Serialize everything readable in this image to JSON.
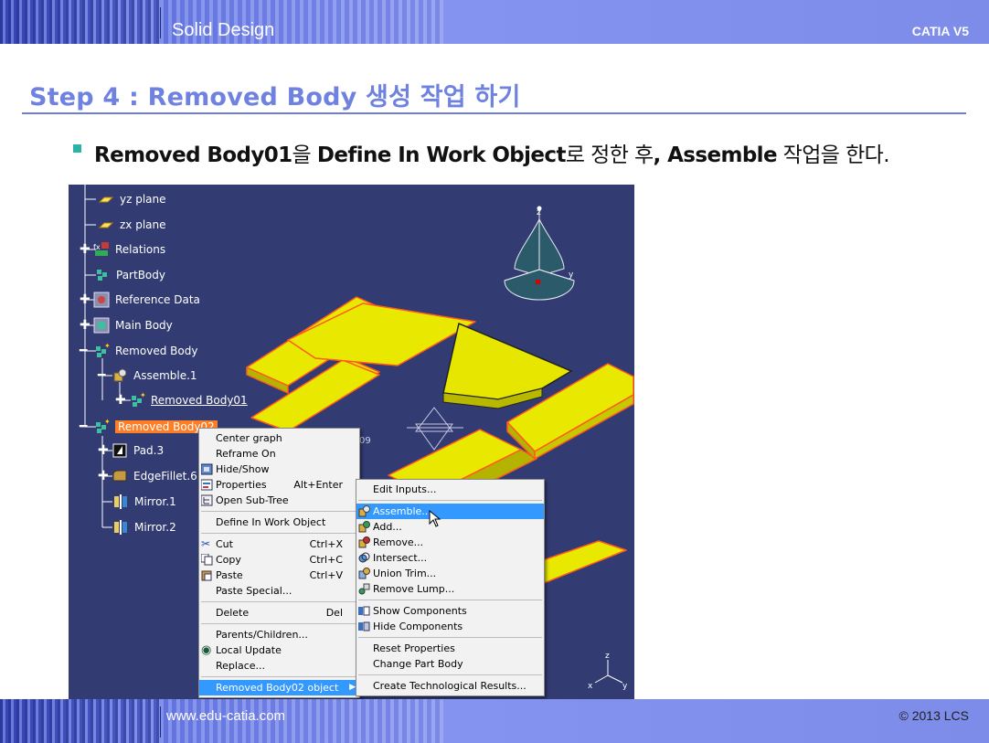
{
  "header": {
    "title": "Solid Design",
    "right": "CATIA V5"
  },
  "footer": {
    "url": "www.edu-catia.com",
    "copyright": "© 2013 LCS"
  },
  "step_title": "Step 4 : Removed Body 생성 작업 하기",
  "bullet": {
    "part1": "Removed Body01",
    "part2": "을 ",
    "part3": "Define In Work Object",
    "part4": "로 정한 후",
    "part5": ", Assemble",
    "part6": " 작업을 한다."
  },
  "tree": {
    "items": [
      {
        "label": "yz plane",
        "icon": "plane-icon"
      },
      {
        "label": "zx plane",
        "icon": "plane-icon"
      },
      {
        "label": "Relations",
        "icon": "relations-icon"
      },
      {
        "label": "PartBody",
        "icon": "partbody-icon"
      },
      {
        "label": "Reference Data",
        "icon": "geometrical-set-icon"
      },
      {
        "label": "Main Body",
        "icon": "geometrical-set-icon"
      },
      {
        "label": "Removed Body",
        "icon": "body-icon"
      },
      {
        "label": "Assemble.1",
        "icon": "assemble-icon"
      },
      {
        "label": "Removed Body01",
        "icon": "body-icon"
      },
      {
        "label": "Removed Body02",
        "icon": "body-icon"
      },
      {
        "label": "Pad.3",
        "icon": "pad-icon"
      },
      {
        "label": "EdgeFillet.6",
        "icon": "edge-fillet-icon"
      },
      {
        "label": "Mirror.1",
        "icon": "mirror-icon"
      },
      {
        "label": "Mirror.2",
        "icon": "mirror-icon"
      }
    ],
    "partial_label": "09"
  },
  "axis": {
    "x": "x",
    "y": "y",
    "z": "z"
  },
  "context_menu": {
    "items": [
      {
        "label": "Center graph",
        "shortcut": ""
      },
      {
        "label": "Reframe On",
        "shortcut": ""
      },
      {
        "label": "Hide/Show",
        "shortcut": ""
      },
      {
        "label": "Properties",
        "shortcut": "Alt+Enter"
      },
      {
        "label": "Open Sub-Tree",
        "shortcut": ""
      },
      {
        "label": "Define In Work Object",
        "shortcut": ""
      },
      {
        "label": "Cut",
        "shortcut": "Ctrl+X"
      },
      {
        "label": "Copy",
        "shortcut": "Ctrl+C"
      },
      {
        "label": "Paste",
        "shortcut": "Ctrl+V"
      },
      {
        "label": "Paste Special...",
        "shortcut": ""
      },
      {
        "label": "Delete",
        "shortcut": "Del"
      },
      {
        "label": "Parents/Children...",
        "shortcut": ""
      },
      {
        "label": "Local Update",
        "shortcut": ""
      },
      {
        "label": "Replace...",
        "shortcut": ""
      },
      {
        "label": "Removed Body02 object",
        "shortcut": ""
      }
    ]
  },
  "submenu": {
    "items": [
      {
        "label": "Edit Inputs..."
      },
      {
        "label": "Assemble..."
      },
      {
        "label": "Add..."
      },
      {
        "label": "Remove..."
      },
      {
        "label": "Intersect..."
      },
      {
        "label": "Union Trim..."
      },
      {
        "label": "Remove Lump..."
      },
      {
        "label": "Show Components"
      },
      {
        "label": "Hide Components"
      },
      {
        "label": "Reset Properties"
      },
      {
        "label": "Change Part Body"
      },
      {
        "label": "Create Technological Results..."
      }
    ]
  },
  "colors": {
    "accent": "#6f82e0",
    "viewport": "#323c72",
    "solid": "#e6e600",
    "edge": "#ff5a1e",
    "highlight": "#3399ff",
    "selected": "#ff7d24"
  }
}
